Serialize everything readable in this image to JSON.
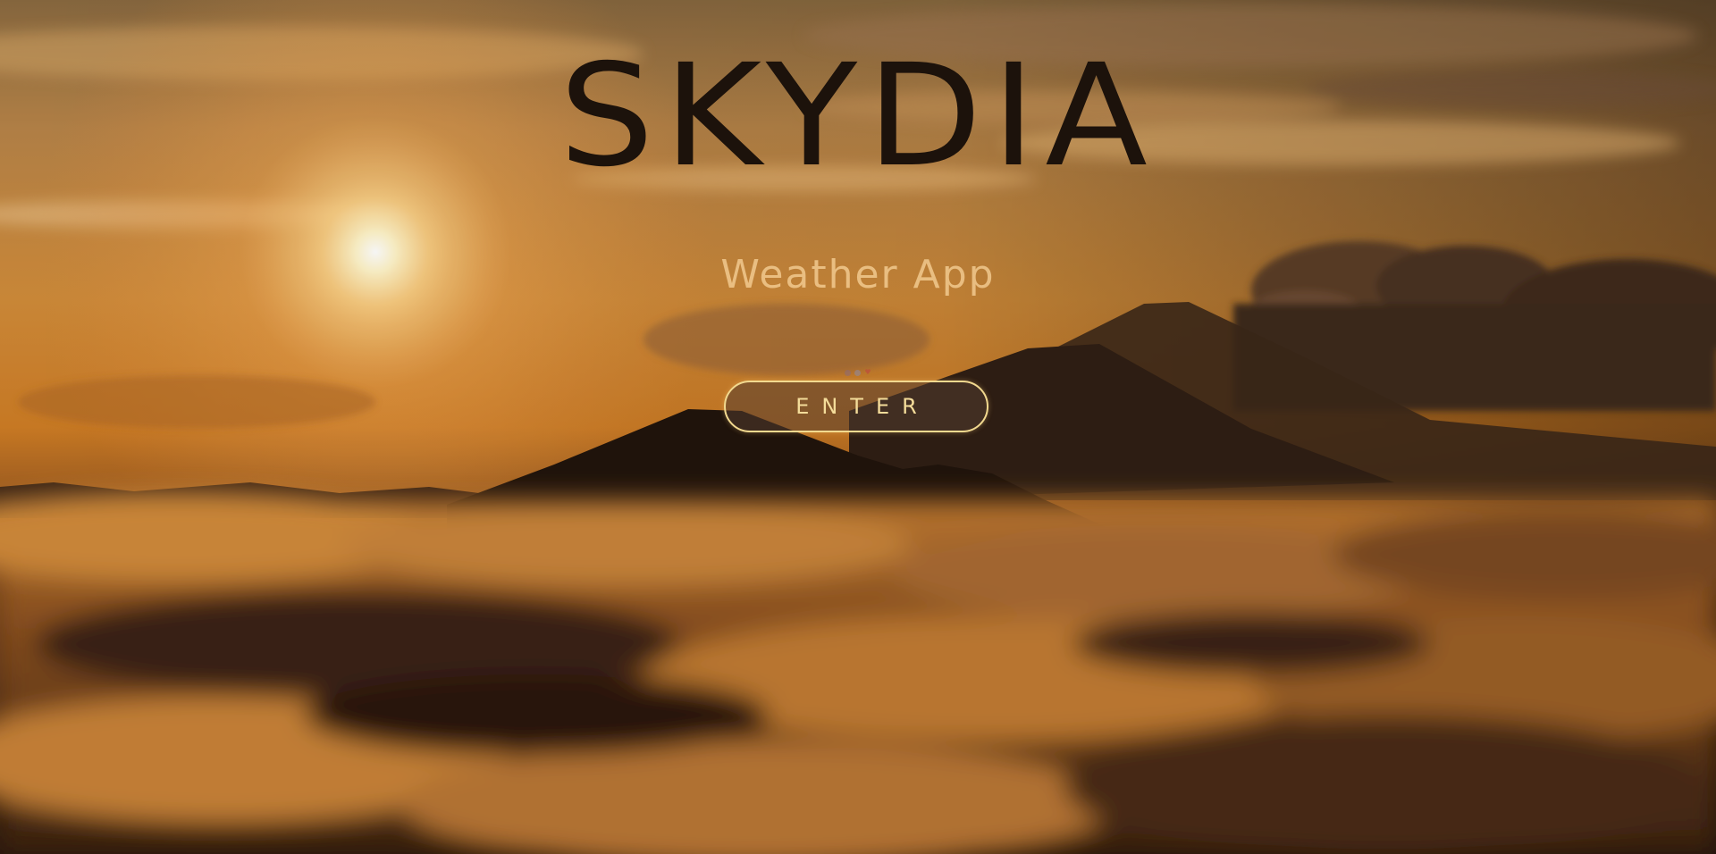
{
  "hero": {
    "title": "SKYDIA",
    "subtitle": "Weather App",
    "enter_label": "ENTER"
  },
  "background": {
    "description_colors": {
      "sky_top": "#c88a3e",
      "sun_glow": "#fff6d8",
      "horizon": "#e08a2c",
      "mountain": "#23160d",
      "cloud_light": "#d9913e",
      "cloud_dark": "#3a220f"
    }
  },
  "colors": {
    "title": "#1c120b",
    "subtitle": "#fad69e",
    "button_border": "#f2d98f",
    "button_text": "#f4dc9a"
  }
}
